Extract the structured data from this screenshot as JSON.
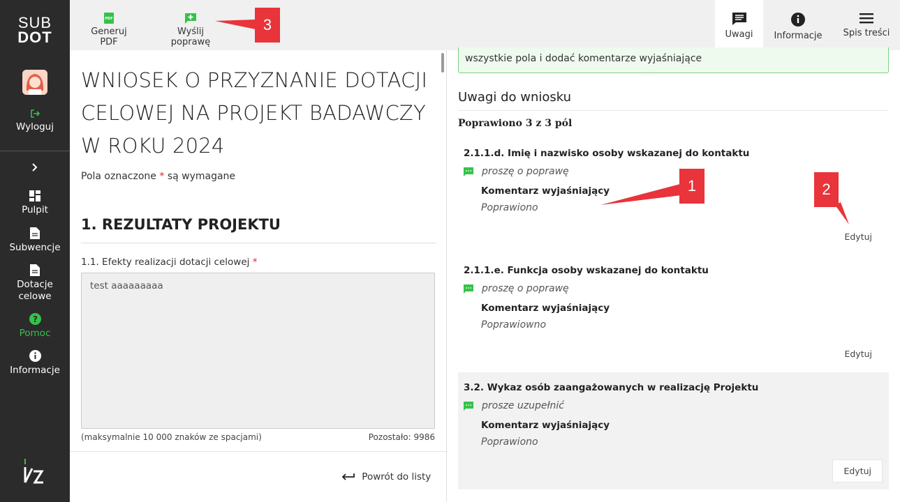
{
  "app": {
    "logo_line1": "SUB",
    "logo_line2": "DOT"
  },
  "sidebar": {
    "logout": "Wyloguj",
    "items": [
      {
        "label": "Pulpit"
      },
      {
        "label": "Subwencje"
      },
      {
        "label": "Dotacje celowe"
      },
      {
        "label": "Pomoc"
      },
      {
        "label": "Informacje"
      }
    ]
  },
  "toolbar": {
    "pdf_label": "Generuj PDF",
    "send_label": "Wyślij poprawę",
    "tabs": [
      {
        "label": "Uwagi",
        "active": true
      },
      {
        "label": "Informacje",
        "active": false
      },
      {
        "label": "Spis treści",
        "active": false
      }
    ]
  },
  "document": {
    "title": "WNIOSEK O PRZYZNANIE DOTACJI CELOWEJ NA PROJEKT BADAWCZY W ROKU 2024",
    "required_note_pre": "Pola oznaczone",
    "required_star": "*",
    "required_note_post": "są wymagane",
    "section_title": "1. REZULTATY PROJEKTU",
    "field_label": "1.1. Efekty realizacji dotacji celowej",
    "field_value": "test aaaaaaaaa",
    "field_hint": "(maksymalnie 10 000 znaków ze spacjami)",
    "field_remaining": "Pozostało: 9986",
    "back_link": "Powrót do listy"
  },
  "remarks": {
    "info_text": "wszystkie pola i dodać komentarze wyjaśniające",
    "title": "Uwagi do wniosku",
    "summary": "Poprawiono 3 z 3 pól",
    "comment_label": "Komentarz wyjaśniający",
    "edit_label": "Edytuj",
    "items": [
      {
        "field": "2.1.1.d. Imię i nazwisko osoby wskazanej do kontaktu",
        "status": "proszę o poprawę",
        "comment": "Poprawiono"
      },
      {
        "field": "2.1.1.e. Funkcja osoby wskazanej do kontaktu",
        "status": "proszę o poprawę",
        "comment": "Poprawiowno"
      },
      {
        "field": "3.2. Wykaz osób zaangażowanych w realizację Projektu",
        "status": "prosze uzupełnić",
        "comment": "Poprawiono"
      }
    ]
  },
  "annotations": {
    "c1": "1",
    "c2": "2",
    "c3": "3"
  },
  "colors": {
    "accent_green": "#35c24a",
    "callout_red": "#e8343a",
    "sidebar_bg": "#2b2b2b"
  }
}
